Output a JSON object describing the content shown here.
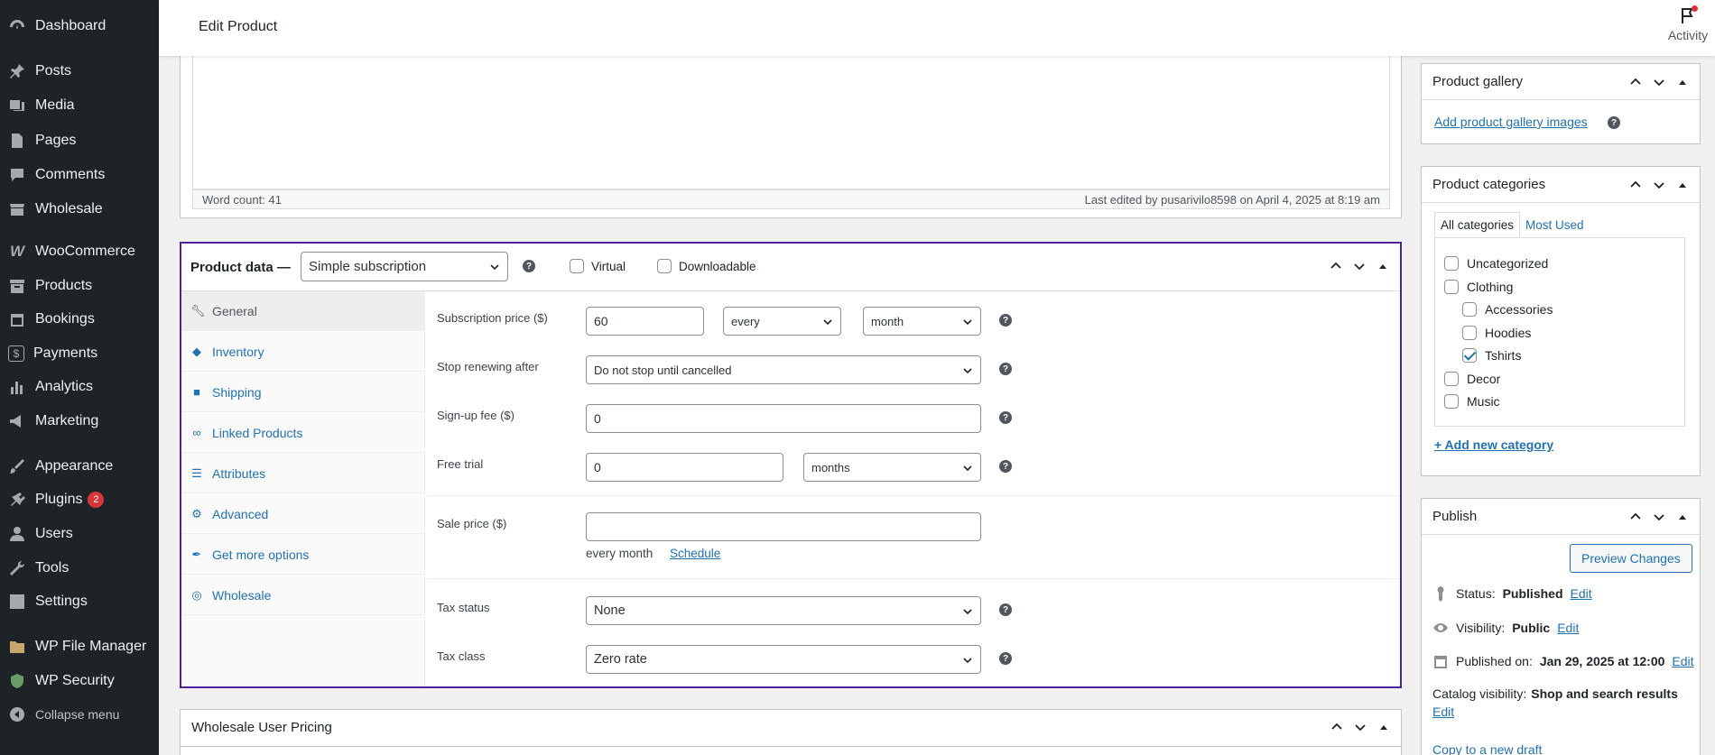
{
  "sidebar": {
    "items": [
      {
        "label": "Dashboard",
        "icon": "dashboard-icon"
      },
      {
        "label": "Posts",
        "icon": "pin-icon"
      },
      {
        "label": "Media",
        "icon": "media-icon"
      },
      {
        "label": "Pages",
        "icon": "pages-icon"
      },
      {
        "label": "Comments",
        "icon": "comment-icon"
      },
      {
        "label": "Wholesale",
        "icon": "store-icon"
      },
      {
        "label": "WooCommerce",
        "icon": "woo-icon"
      },
      {
        "label": "Products",
        "icon": "archive-icon"
      },
      {
        "label": "Bookings",
        "icon": "calendar-icon"
      },
      {
        "label": "Payments",
        "icon": "dollar-icon"
      },
      {
        "label": "Analytics",
        "icon": "chart-bar-icon"
      },
      {
        "label": "Marketing",
        "icon": "megaphone-icon"
      },
      {
        "label": "Appearance",
        "icon": "brush-icon"
      },
      {
        "label": "Plugins",
        "icon": "plugin-icon",
        "badge": "2"
      },
      {
        "label": "Users",
        "icon": "user-icon"
      },
      {
        "label": "Tools",
        "icon": "wrench-icon"
      },
      {
        "label": "Settings",
        "icon": "settings-icon"
      },
      {
        "label": "WP File Manager",
        "icon": "folder-icon"
      },
      {
        "label": "WP Security",
        "icon": "shield-icon"
      }
    ],
    "collapse_label": "Collapse menu"
  },
  "header": {
    "title": "Edit Product",
    "activity_label": "Activity"
  },
  "editor": {
    "word_count": "Word count: 41",
    "last_edited": "Last edited by pusarivilo8598 on April 4, 2025 at 8:19 am"
  },
  "product_data": {
    "title": "Product data —",
    "type_selected": "Simple subscription",
    "virtual_label": "Virtual",
    "downloadable_label": "Downloadable",
    "tabs": [
      {
        "label": "General",
        "icon": "wrench-icon"
      },
      {
        "label": "Inventory",
        "icon": "tag-icon"
      },
      {
        "label": "Shipping",
        "icon": "truck-icon"
      },
      {
        "label": "Linked Products",
        "icon": "link-icon"
      },
      {
        "label": "Attributes",
        "icon": "list-icon"
      },
      {
        "label": "Advanced",
        "icon": "gear-icon"
      },
      {
        "label": "Get more options",
        "icon": "plugin-icon"
      },
      {
        "label": "Wholesale",
        "icon": "visibility-icon"
      }
    ],
    "fields": {
      "subscription_price_label": "Subscription price ($)",
      "subscription_price_value": "60",
      "interval_value": "every",
      "period_value": "month",
      "stop_renewing_label": "Stop renewing after",
      "stop_renewing_value": "Do not stop until cancelled",
      "signup_fee_label": "Sign-up fee ($)",
      "signup_fee_value": "0",
      "free_trial_label": "Free trial",
      "free_trial_value": "0",
      "free_trial_period": "months",
      "sale_price_label": "Sale price ($)",
      "sale_price_value": "",
      "sale_price_suffix": "every month",
      "schedule_label": "Schedule",
      "tax_status_label": "Tax status",
      "tax_status_value": "None",
      "tax_class_label": "Tax class",
      "tax_class_value": "Zero rate"
    }
  },
  "wholesale_box": {
    "title": "Wholesale User Pricing"
  },
  "product_gallery": {
    "title": "Product gallery",
    "add_link": "Add product gallery images"
  },
  "product_categories": {
    "title": "Product categories",
    "tab_all": "All categories",
    "tab_most_used": "Most Used",
    "categories": [
      {
        "label": "Uncategorized",
        "checked": false
      },
      {
        "label": "Clothing",
        "checked": false
      },
      {
        "label": "Accessories",
        "checked": false
      },
      {
        "label": "Hoodies",
        "checked": false
      },
      {
        "label": "Tshirts",
        "checked": true
      },
      {
        "label": "Decor",
        "checked": false
      },
      {
        "label": "Music",
        "checked": false
      }
    ],
    "add_new": "+ Add new category"
  },
  "publish": {
    "title": "Publish",
    "preview_button": "Preview Changes",
    "status_label": "Status:",
    "status_value": "Published",
    "visibility_label": "Visibility:",
    "visibility_value": "Public",
    "published_on_label": "Published on:",
    "published_on_value": "Jan 29, 2025 at 12:00",
    "catalog_label": "Catalog visibility:",
    "catalog_value": "Shop and search results",
    "edit_label": "Edit",
    "copy_draft": "Copy to a new draft"
  },
  "colors": {
    "sidebar_bg": "#1d2327",
    "accent": "#2271b1",
    "highlight_border": "#4f1f9d",
    "badge": "#d63638"
  }
}
